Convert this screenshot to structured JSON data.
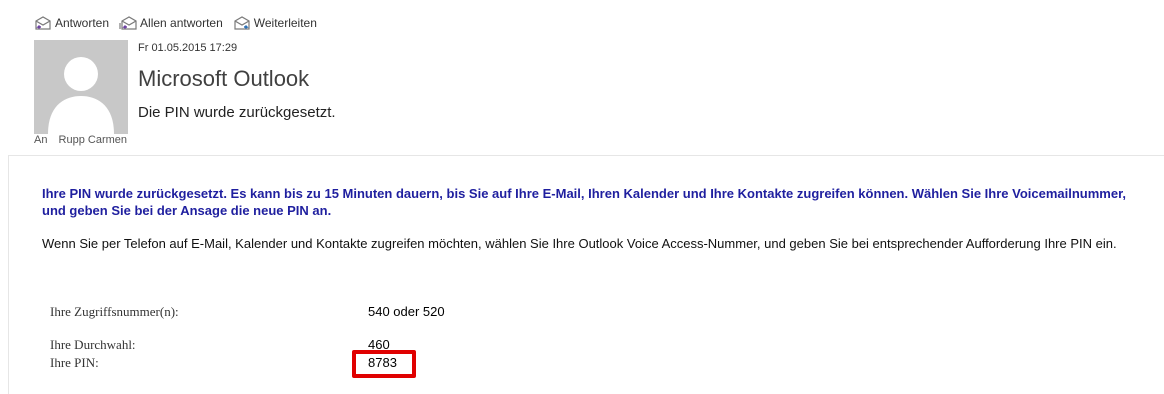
{
  "actions": [
    {
      "label": "Antworten",
      "icon": "reply-icon"
    },
    {
      "label": "Allen antworten",
      "icon": "reply-all-icon"
    },
    {
      "label": "Weiterleiten",
      "icon": "forward-icon"
    }
  ],
  "header": {
    "date": "Fr 01.05.2015 17:29",
    "sender": "Microsoft Outlook",
    "subject": "Die PIN wurde zurückgesetzt.",
    "to_label": "An",
    "to_value": "Rupp Carmen",
    "avatar_icon": "person-placeholder-icon"
  },
  "body": {
    "para1": "Ihre PIN wurde zurückgesetzt. Es kann bis zu 15 Minuten dauern, bis Sie auf Ihre E-Mail, Ihren Kalender und Ihre Kontakte zugreifen können. Wählen Sie Ihre Voicemailnummer, und geben Sie bei der Ansage die neue PIN an.",
    "para2": "Wenn Sie per Telefon auf E-Mail, Kalender und Kontakte zugreifen möchten, wählen Sie Ihre Outlook Voice Access-Nummer, und geben Sie bei entsprechender Aufforderung Ihre PIN ein.",
    "info": [
      {
        "label": "Ihre Zugriffsnummer(n):",
        "value": "540 oder 520"
      },
      {
        "label": "Ihre Durchwahl:",
        "value": "460"
      },
      {
        "label": "Ihre PIN:",
        "value": "8783"
      }
    ]
  },
  "colors": {
    "highlight_box": "#e00000",
    "blue_text": "#1f1f9f",
    "avatar_bg": "#c8c8c8"
  }
}
